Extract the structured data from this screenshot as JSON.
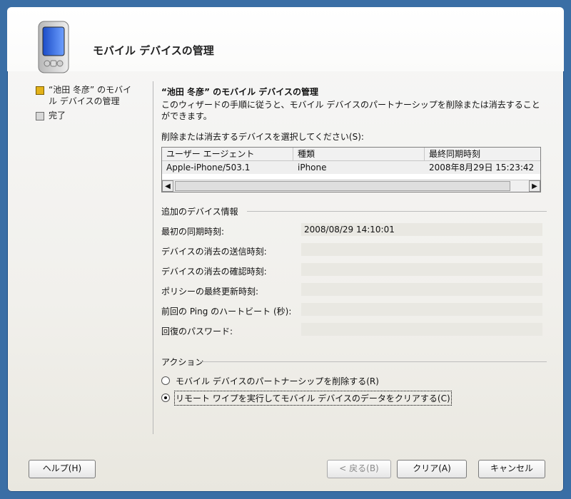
{
  "window": {
    "title": "モバイル デバイスの管理"
  },
  "nav": {
    "items": [
      {
        "label": "“池田 冬彦” のモバイ\nル デバイスの管理",
        "active": true
      },
      {
        "label": "完了",
        "active": false
      }
    ]
  },
  "content": {
    "section_title": "“池田 冬彦” のモバイル デバイスの管理",
    "description": "このウィザードの手順に従うと、モバイル デバイスのパートナーシップを削除または消去すること\nができます。",
    "select_label": "削除または消去するデバイスを選択してください(S):",
    "table": {
      "columns": [
        "ユーザー エージェント",
        "種類",
        "最終同期時刻"
      ],
      "rows": [
        [
          "Apple-iPhone/503.1",
          "iPhone",
          "2008年8月29日 15:23:42"
        ]
      ]
    },
    "additional_info_title": "追加のデバイス情報",
    "info": [
      {
        "label": "最初の同期時刻:",
        "value": "2008/08/29 14:10:01"
      },
      {
        "label": "デバイスの消去の送信時刻:",
        "value": ""
      },
      {
        "label": "デバイスの消去の確認時刻:",
        "value": ""
      },
      {
        "label": "ポリシーの最終更新時刻:",
        "value": ""
      },
      {
        "label": "前回の Ping のハートビート (秒):",
        "value": ""
      },
      {
        "label": "回復のパスワード:",
        "value": ""
      }
    ],
    "actions_title": "アクション",
    "actions": [
      {
        "label": "モバイル デバイスのパートナーシップを削除する(R)",
        "checked": false
      },
      {
        "label": "リモート ワイプを実行してモバイル デバイスのデータをクリアする(C)",
        "checked": true
      }
    ]
  },
  "buttons": {
    "help": "ヘルプ(H)",
    "back": "< 戻る(B)",
    "clear": "クリア(A)",
    "cancel": "キャンセル"
  }
}
